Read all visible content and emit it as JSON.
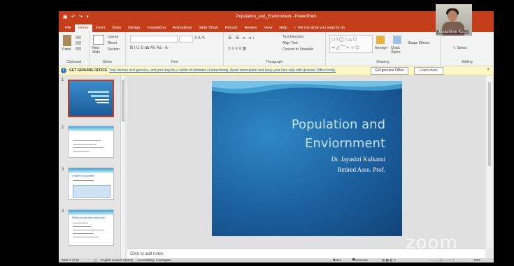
{
  "window": {
    "title": "Population_and_Enviornment - PowerPoint"
  },
  "tabs": [
    "File",
    "Home",
    "Insert",
    "Draw",
    "Design",
    "Transitions",
    "Animations",
    "Slide Show",
    "Record",
    "Review",
    "View",
    "Help"
  ],
  "tell_me": "Tell me what you want to do",
  "ribbon": {
    "clipboard": {
      "label": "Clipboard",
      "paste": "Paste"
    },
    "slides": {
      "label": "Slides",
      "new_slide": "New Slide",
      "layout": "Layout",
      "reset": "Reset",
      "section": "Section"
    },
    "font": {
      "label": "Font"
    },
    "paragraph": {
      "label": "Paragraph",
      "text_direction": "Text Direction",
      "align_text": "Align Text",
      "convert_smartart": "Convert to SmartArt"
    },
    "drawing": {
      "label": "Drawing",
      "arrange": "Arrange",
      "quick_styles": "Quick Styles",
      "shape_effects": "Shape Effects"
    },
    "editing": {
      "label": "Editing",
      "select": "Select"
    }
  },
  "infobar": {
    "title": "GET GENUINE OFFICE",
    "message": "Your license isn't genuine, and you may be a victim of software counterfeiting. Avoid interruption and keep your files safe with genuine Office today.",
    "btn_genuine": "Get genuine Office",
    "btn_learn": "Learn more",
    "close": "×"
  },
  "thumbnails": [
    {
      "num": "1"
    },
    {
      "num": "2"
    },
    {
      "num": "3",
      "title": "Growth in population"
    },
    {
      "num": "4",
      "title": "Effects of population explosion"
    }
  ],
  "slide": {
    "title_line1": "Population and",
    "title_line2": "Enviornment",
    "subtitle_line1": "Dr. Jayashri Kulkarni",
    "subtitle_line2": "Retired Asso. Prof."
  },
  "notes": {
    "placeholder": "Click to add notes"
  },
  "status": {
    "slide_of": "Slide 1 of 10",
    "language": "English (United States)",
    "accessibility": "Accessibility: Investigate",
    "notes": "Notes",
    "comments": "Comments",
    "zoom": "63%"
  },
  "participant": {
    "name": "Jayashree Ku..."
  },
  "watermark": "zoom",
  "colors": {
    "accent": "#c43e1c",
    "slide_bg": "#1b5f9f",
    "info_bg": "#fdf7c4"
  }
}
